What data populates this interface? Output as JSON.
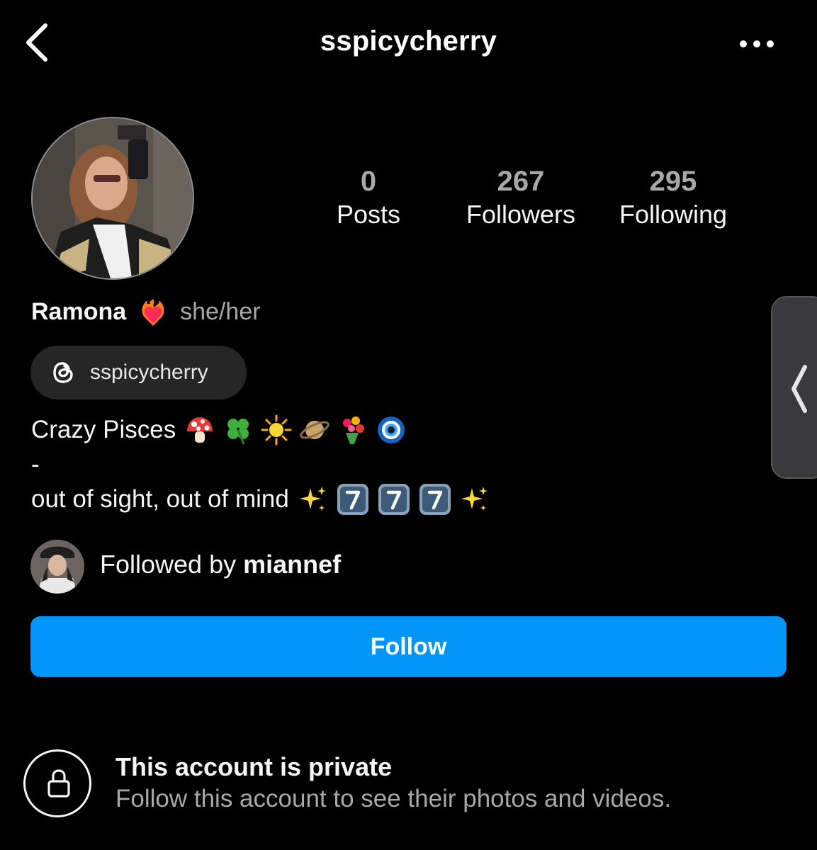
{
  "header": {
    "username": "sspicycherry"
  },
  "stats": {
    "posts_count": "0",
    "posts_label": "Posts",
    "followers_count": "267",
    "followers_label": "Followers",
    "following_count": "295",
    "following_label": "Following"
  },
  "profile": {
    "display_name": "Ramona",
    "pronouns": "she/her",
    "threads_handle": "sspicycherry"
  },
  "bio": {
    "line1_text": "Crazy Pisces",
    "line2_text": "-",
    "line3_text": "out of sight, out of mind"
  },
  "followed_by": {
    "prefix": "Followed by ",
    "username": "miannef"
  },
  "follow_button": {
    "label": "Follow",
    "color": "#0095f6"
  },
  "private_notice": {
    "title": "This account is private",
    "subtitle": "Follow this account to see their photos and videos."
  },
  "icons": {
    "back": "chevron-left-icon",
    "more": "more-horizontal-icon",
    "threads": "threads-icon",
    "lock": "lock-icon",
    "side_tab": "chevron-left-icon"
  }
}
